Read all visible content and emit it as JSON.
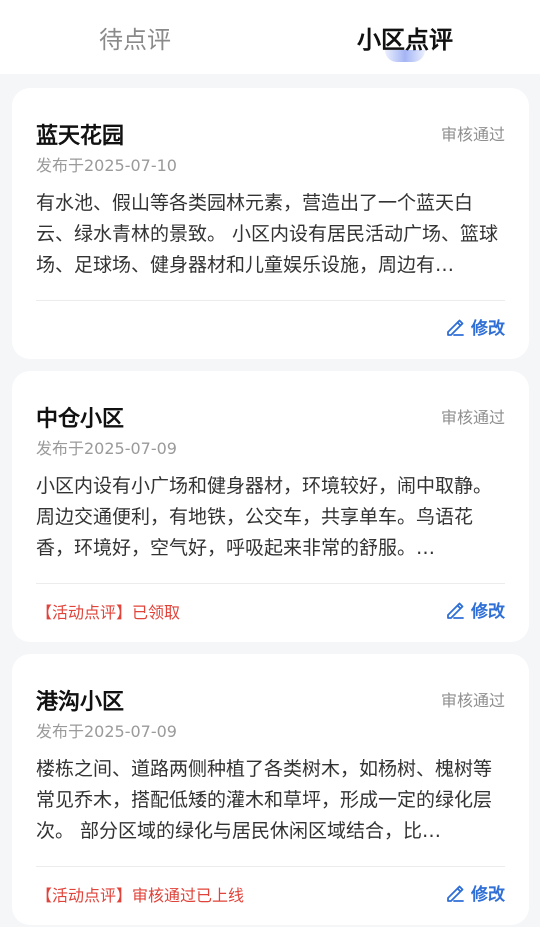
{
  "tabs": [
    {
      "label": "待点评",
      "active": false
    },
    {
      "label": "小区点评",
      "active": true
    }
  ],
  "edit_label": "修改",
  "accent_color": "#2f6fd6",
  "tag_color": "#e0433a",
  "reviews": [
    {
      "title": "蓝天花园",
      "status": "审核通过",
      "date": "发布于2025-07-10",
      "content": "有水池、假山等各类园林元素，营造出了一个蓝天白云、绿水青林的景致。 小区内设有居民活动广场、篮球场、足球场、健身器材和儿童娱乐设施，周边有…",
      "tag": ""
    },
    {
      "title": "中仓小区",
      "status": "审核通过",
      "date": "发布于2025-07-09",
      "content": "小区内设有小广场和健身器材，环境较好，闹中取静。周边交通便利，有地铁，公交车，共享单车。鸟语花香，环境好，空气好，呼吸起来非常的舒服。…",
      "tag": "【活动点评】已领取"
    },
    {
      "title": "港沟小区",
      "status": "审核通过",
      "date": "发布于2025-07-09",
      "content": "楼栋之间、道路两侧种植了各类树木，如杨树、槐树等常见乔木，搭配低矮的灌木和草坪，形成一定的绿化层次。 部分区域的绿化与居民休闲区域结合，比…",
      "tag": "【活动点评】审核通过已上线"
    }
  ]
}
